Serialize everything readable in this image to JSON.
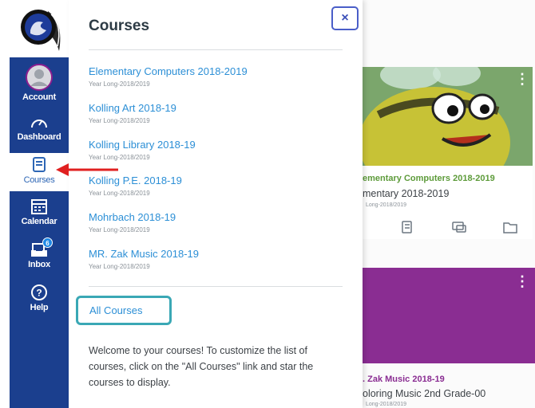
{
  "nav": {
    "items": [
      {
        "label": "Account",
        "icon": "account-avatar-icon"
      },
      {
        "label": "Dashboard",
        "icon": "dashboard-icon"
      },
      {
        "label": "Courses",
        "icon": "courses-book-icon"
      },
      {
        "label": "Calendar",
        "icon": "calendar-icon"
      },
      {
        "label": "Inbox",
        "icon": "inbox-icon",
        "badge": "6"
      },
      {
        "label": "Help",
        "icon": "help-icon"
      }
    ]
  },
  "tray": {
    "title": "Courses",
    "close_label": "×",
    "courses": [
      {
        "name": "Elementary Computers 2018-2019",
        "term": "Year Long-2018/2019"
      },
      {
        "name": "Kolling Art 2018-19",
        "term": "Year Long-2018/2019"
      },
      {
        "name": "Kolling Library 2018-19",
        "term": "Year Long-2018/2019"
      },
      {
        "name": "Kolling P.E. 2018-19",
        "term": "Year Long-2018/2019"
      },
      {
        "name": "Mohrbach 2018-19",
        "term": "Year Long-2018/2019"
      },
      {
        "name": "MR. Zak Music 2018-19",
        "term": "Year Long-2018/2019"
      }
    ],
    "all_courses_label": "All Courses",
    "welcome_text": "Welcome to your courses! To customize the list of courses, click on the \"All Courses\" link and star the courses to display."
  },
  "dashboard": {
    "card1": {
      "name": "ementary Computers 2018-2019",
      "subtitle": "mentary 2018-2019",
      "term": "Long-2018/2019",
      "color": "#7ba66c",
      "name_color": "#5d9b3a"
    },
    "card2": {
      "name": ". Zak Music 2018-19",
      "subtitle": "oloring Music 2nd Grade-00",
      "term": "Long-2018/2019",
      "color": "#8a2d92",
      "name_color": "#8a2d92"
    }
  },
  "colors": {
    "nav_bg": "#1b3f8e",
    "link": "#2c8fd6",
    "focus_ring": "#3aa8b5",
    "arrow": "#e02020"
  }
}
